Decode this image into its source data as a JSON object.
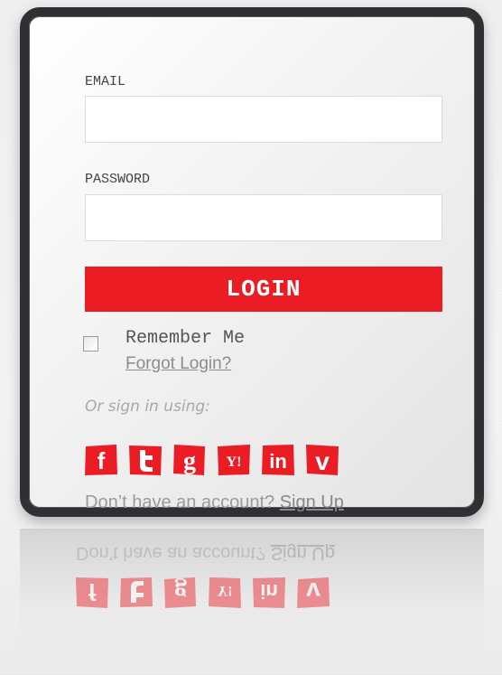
{
  "form": {
    "email_label": "EMAIL",
    "email_value": "",
    "password_label": "PASSWORD",
    "password_value": "",
    "login_label": "LOGIN",
    "remember_label": "Remember Me",
    "forgot_label": "Forgot Login?",
    "alt_label": "Or sign in using:",
    "signup_prompt": "Don’t have an account?",
    "signup_link": "Sign Up"
  },
  "socials": [
    {
      "icon": "facebook-icon",
      "glyph": "f"
    },
    {
      "icon": "twitter-icon",
      "glyph": "t"
    },
    {
      "icon": "google-icon",
      "glyph": "g"
    },
    {
      "icon": "yahoo-icon",
      "glyph": "Y!"
    },
    {
      "icon": "linkedin-icon",
      "glyph": "in"
    },
    {
      "icon": "vimeo-icon",
      "glyph": "v"
    }
  ],
  "colors": {
    "accent": "#ec1c24",
    "frame": "#2f3033"
  }
}
